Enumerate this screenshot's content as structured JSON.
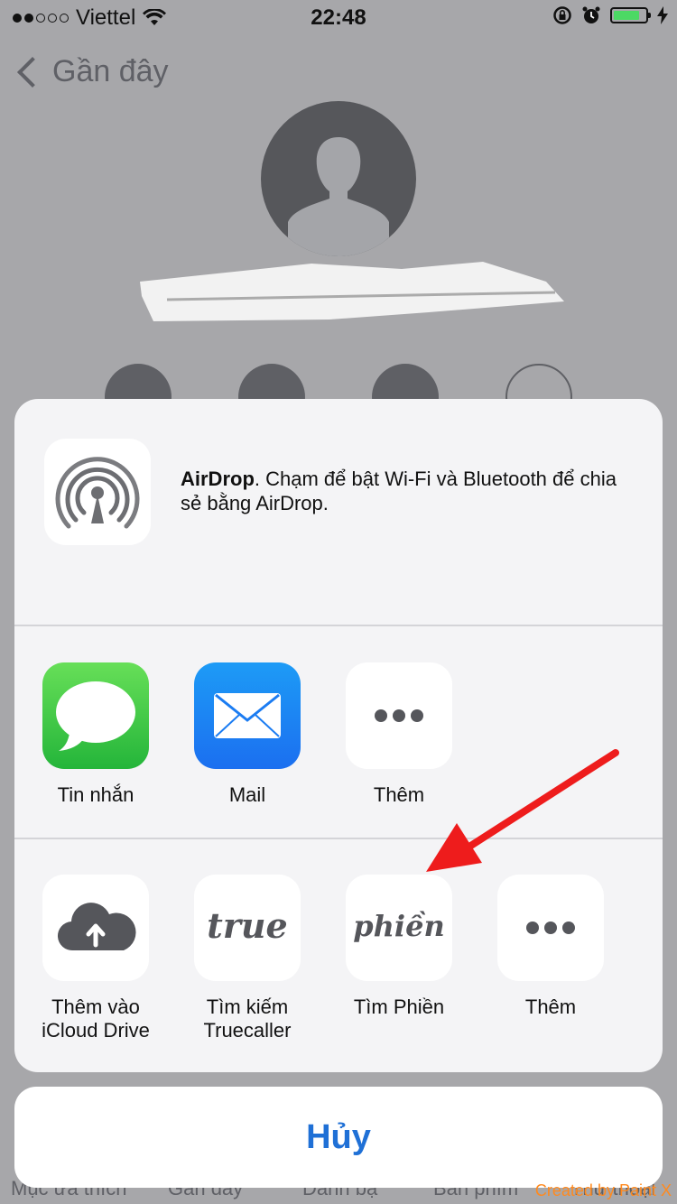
{
  "status_bar": {
    "carrier": "Viettel",
    "time": "22:48",
    "signal_dots_full": 2,
    "signal_dots_total": 5,
    "battery_color": "#4cd964"
  },
  "background": {
    "back_label": "Gần đây",
    "tab_labels": [
      "Mục ưa thích",
      "Gần đây",
      "Danh bạ",
      "Bàn phím",
      "Thư thoại"
    ]
  },
  "share_sheet": {
    "airdrop": {
      "title": "AirDrop",
      "description": ". Chạm để bật Wi-Fi và Bluetooth để chia sẻ bằng AirDrop."
    },
    "row1": [
      {
        "label": "Tin nhắn",
        "icon": "messages-icon"
      },
      {
        "label": "Mail",
        "icon": "mail-icon"
      },
      {
        "label": "Thêm",
        "icon": "more-icon"
      }
    ],
    "row2": [
      {
        "label": "Thêm vào\niCloud Drive",
        "icon": "icloud-upload-icon"
      },
      {
        "label": "Tìm kiếm\nTruecaller",
        "icon": "truecaller-icon",
        "logo_text": "true"
      },
      {
        "label": "Tìm Phiền",
        "icon": "timphien-icon",
        "logo_text": "phiền"
      },
      {
        "label": "Thêm",
        "icon": "more-icon"
      }
    ],
    "cancel_label": "Hủy"
  },
  "watermark": "Created by Paint X",
  "colors": {
    "accent_blue": "#1f70d6",
    "arrow_red": "#ee1c1c",
    "watermark_orange": "#ff8a1f"
  }
}
